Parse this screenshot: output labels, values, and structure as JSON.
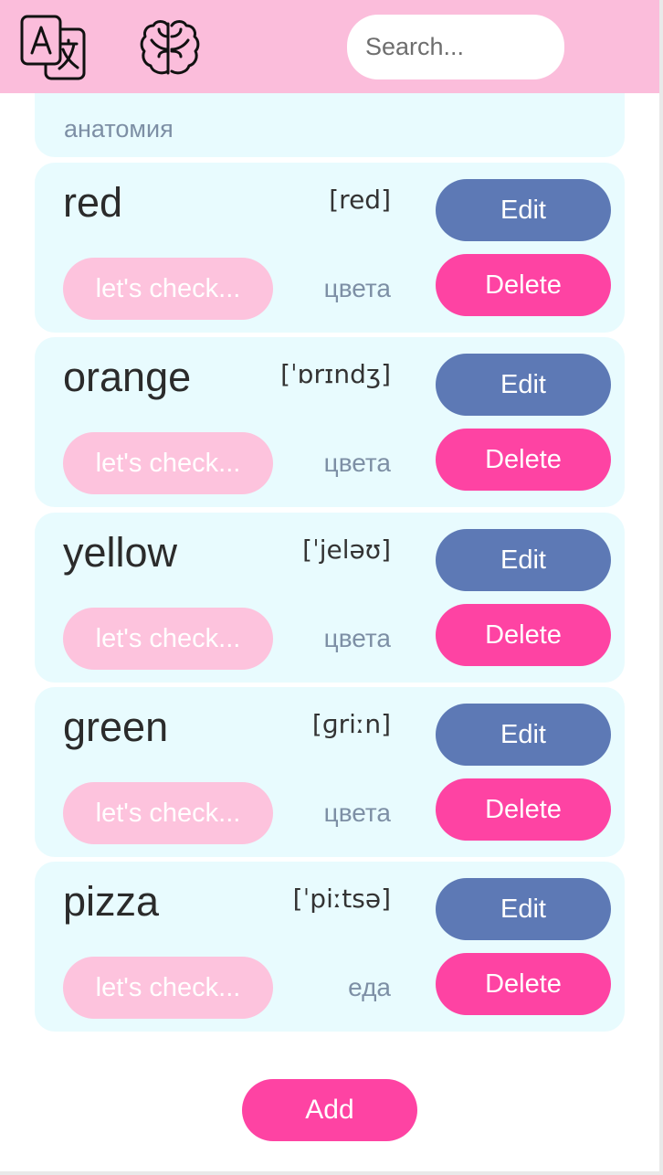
{
  "header": {
    "translate_icon": "translate-icon",
    "brain_icon": "brain-icon",
    "search_placeholder": "Search..."
  },
  "partial_card": {
    "topic": "анатомия"
  },
  "cards": [
    {
      "word": "red",
      "transcription": "[red]",
      "check_label": "let's check...",
      "topic": "цвета",
      "edit_label": "Edit",
      "delete_label": "Delete"
    },
    {
      "word": "orange",
      "transcription": "[ˈɒrɪndʒ]",
      "check_label": "let's check...",
      "topic": "цвета",
      "edit_label": "Edit",
      "delete_label": "Delete"
    },
    {
      "word": "yellow",
      "transcription": "[ˈjeləʊ]",
      "check_label": "let's check...",
      "topic": "цвета",
      "edit_label": "Edit",
      "delete_label": "Delete"
    },
    {
      "word": "green",
      "transcription": "[ɡriːn]",
      "check_label": "let's check...",
      "topic": "цвета",
      "edit_label": "Edit",
      "delete_label": "Delete"
    },
    {
      "word": "pizza",
      "transcription": "[ˈpiːtsə]",
      "check_label": "let's check...",
      "topic": "еда",
      "edit_label": "Edit",
      "delete_label": "Delete"
    }
  ],
  "add_label": "Add",
  "colors": {
    "header": "#fbbddb",
    "card": "#e8fbfe",
    "edit": "#5d79b5",
    "delete": "#fe43a3",
    "check": "#fdc3dd",
    "topic_text": "#7d8fa5"
  }
}
